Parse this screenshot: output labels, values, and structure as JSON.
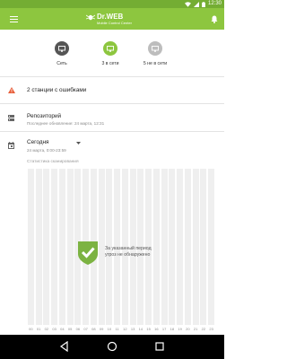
{
  "status_bar": {
    "time": "12:30"
  },
  "app_bar": {
    "brand": "Dr.WEB",
    "subtitle": "Mobile Control Center",
    "accent_color": "#8dc63f",
    "menu_icon": "hamburger-menu-icon",
    "notification_icon": "bell-icon"
  },
  "summary": {
    "network": {
      "label": "Сеть",
      "color": "#555555"
    },
    "online": {
      "label": "3 в сети",
      "color": "#8dc63f"
    },
    "offline": {
      "label": "5 не в сети",
      "color": "#bdbdbd"
    }
  },
  "errors_row": {
    "text": "2 станции с ошибками",
    "icon": "warning-icon",
    "color": "#e8603c"
  },
  "repository_row": {
    "title": "Репозиторий",
    "subtitle": "Последнее обновление: 24 марта, 12:31",
    "icon": "server-icon"
  },
  "period_row": {
    "title": "Сегодня",
    "subtitle": "24 марта, 0:00-23:59",
    "icon": "calendar-icon",
    "dropdown_icon": "dropdown-arrow-icon"
  },
  "chart_data": {
    "type": "bar",
    "title": "Статистика сканирования",
    "categories": [
      "00",
      "01",
      "02",
      "03",
      "04",
      "05",
      "06",
      "07",
      "08",
      "09",
      "10",
      "11",
      "12",
      "13",
      "14",
      "15",
      "16",
      "17",
      "18",
      "19",
      "20",
      "21",
      "22",
      "23"
    ],
    "values": [
      0,
      0,
      0,
      0,
      0,
      0,
      0,
      0,
      0,
      0,
      0,
      0,
      0,
      0,
      0,
      0,
      0,
      0,
      0,
      0,
      0,
      0,
      0,
      0
    ],
    "status_line1": "За указанный период",
    "status_line2": "угроз не обнаружено"
  }
}
